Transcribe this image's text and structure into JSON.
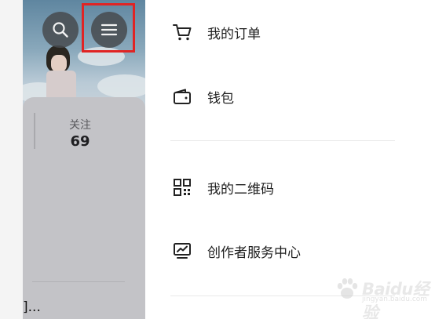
{
  "profile": {
    "follow_label": "关注",
    "follow_count": "69",
    "truncated_text": "]..."
  },
  "header_buttons": {
    "search_icon": "search-icon",
    "menu_icon": "hamburger-menu-icon",
    "highlight_color": "#e02424"
  },
  "menu": {
    "items": [
      {
        "label": "我的订单",
        "icon": "cart-icon"
      },
      {
        "label": "钱包",
        "icon": "wallet-icon"
      },
      {
        "label": "我的二维码",
        "icon": "qr-code-icon"
      },
      {
        "label": "创作者服务中心",
        "icon": "creator-monitor-icon"
      }
    ]
  },
  "watermark": {
    "text": "Baidu经验",
    "subtext": "jingyan.baidu.com"
  },
  "colors": {
    "dim_overlay": "#b4b4b8",
    "drawer_bg": "#ffffff",
    "text_primary": "#1e1e1e"
  }
}
